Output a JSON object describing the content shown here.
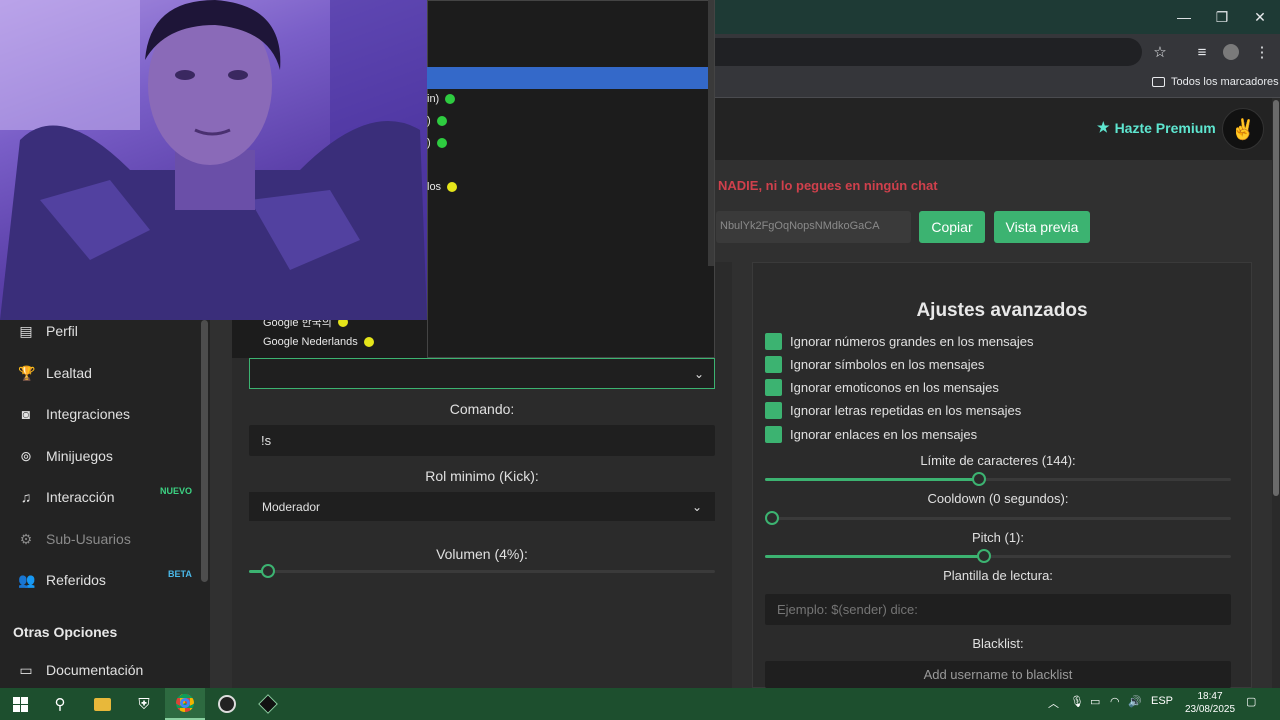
{
  "browser": {
    "window_controls": {
      "minimize": "—",
      "maximize": "❐",
      "close": "✕"
    },
    "bookmarks_label": "Todos los marcadores"
  },
  "header": {
    "premium_label": "Hazte Premium",
    "warning": "NADIE, ni lo pegues en ningún chat",
    "url_value": "NbulYk2FgOqNopsNMdkoGaCA",
    "copy_button": "Copiar",
    "preview_button": "Vista previa"
  },
  "sidebar": {
    "items": [
      {
        "label": "Perfil",
        "icon": "id-card-icon"
      },
      {
        "label": "Lealtad",
        "icon": "trophy-icon"
      },
      {
        "label": "Integraciones",
        "icon": "discord-icon"
      },
      {
        "label": "Minijuegos",
        "icon": "gamepad-icon"
      },
      {
        "label": "Interacción",
        "icon": "music-note-icon",
        "badge": "NUEVO"
      },
      {
        "label": "Sub-Usuarios",
        "icon": "user-gear-icon"
      },
      {
        "label": "Referidos",
        "icon": "users-icon",
        "badge": "BETA"
      }
    ],
    "section_title": "Otras Opciones",
    "doc_label": "Documentación"
  },
  "dropdown": {
    "partial_items": [
      "in)",
      ")",
      ")",
      "los"
    ],
    "items": [
      "Google 한국의",
      "Google Nederlands"
    ]
  },
  "left_card": {
    "command_label": "Comando:",
    "command_value": "!s",
    "role_label": "Rol minimo (Kick):",
    "role_value": "Moderador",
    "volume_label": "Volumen (4%):",
    "volume_percent": 4
  },
  "right_card": {
    "title": "Ajustes avanzados",
    "checkboxes": [
      "Ignorar números grandes en los mensajes",
      "Ignorar símbolos en los mensajes",
      "Ignorar emoticonos en los mensajes",
      "Ignorar letras repetidas en los mensajes",
      "Ignorar enlaces en los mensajes"
    ],
    "char_limit_label": "Límite de caracteres (144):",
    "char_limit_fraction": 0.46,
    "cooldown_label": "Cooldown (0 segundos):",
    "cooldown_fraction": 0,
    "pitch_label": "Pitch (1):",
    "pitch_fraction": 0.47,
    "template_label": "Plantilla de lectura:",
    "template_placeholder": "Ejemplo: $(sender) dice:",
    "blacklist_label": "Blacklist:",
    "blacklist_placeholder": "Add username to blacklist"
  },
  "taskbar": {
    "lang": "ESP",
    "time": "18:47",
    "date": "23/08/2025"
  },
  "colors": {
    "accent_green": "#3cb371",
    "warning_red": "#d0404c",
    "premium_teal": "#5ee6d0"
  }
}
